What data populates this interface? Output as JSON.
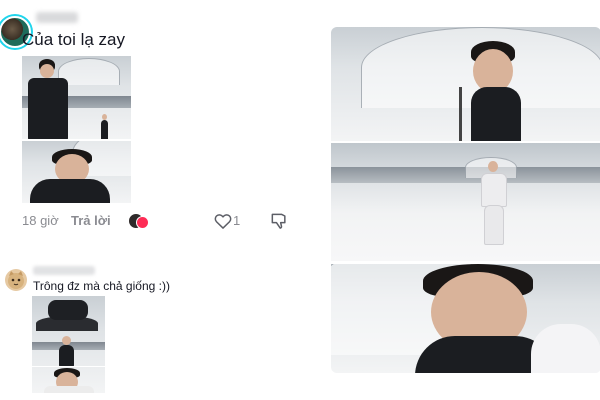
{
  "comment": {
    "text": "Của toi lạ zay",
    "time": "18 giờ",
    "reply_label": "Trả lời",
    "like_count": "1",
    "icons": [
      "heart-outline-icon",
      "dislike-icon"
    ]
  },
  "reply": {
    "text": "Trông đz mà chả giống :))"
  },
  "colors": {
    "accent_ring": "#20d5ec",
    "secondary_text": "#8a8b91",
    "primary_text": "#161823"
  }
}
